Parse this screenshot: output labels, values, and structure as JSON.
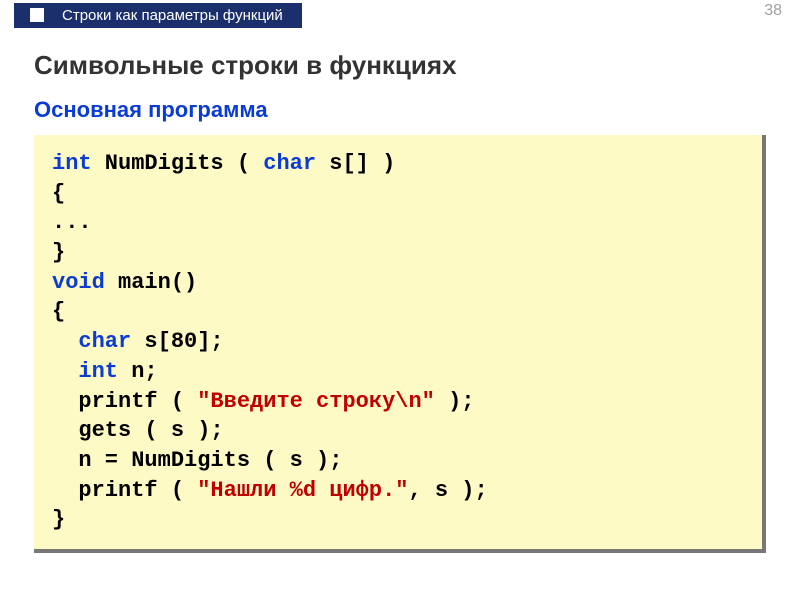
{
  "header": {
    "crumb": "Строки как параметры функций",
    "page_number": "38"
  },
  "main": {
    "title": "Символьные строки в функциях",
    "subtitle": "Основная программа"
  },
  "code": {
    "kw_int1": "int",
    "func_decl_rest": " NumDigits ( ",
    "kw_char1": "char",
    "param_rest": " s[] )",
    "brace_open1": "{",
    "ellipsis": "...",
    "brace_close1": "}",
    "kw_void": "void",
    "main_rest": " main()",
    "brace_open2": "{",
    "indent": "  ",
    "kw_char2": "char",
    "decl_s": " s[80];",
    "kw_int2": "int",
    "decl_n": " n;",
    "printf1_a": "  printf ( ",
    "str1": "\"Введите строку\\n\"",
    "printf1_b": " );",
    "gets_line": "  gets ( s );",
    "assign_line": "  n = NumDigits ( s );",
    "printf2_a": "  printf ( ",
    "str2": "\"Нашли %d цифр.\"",
    "printf2_b": ", s );",
    "brace_close2": "}"
  }
}
